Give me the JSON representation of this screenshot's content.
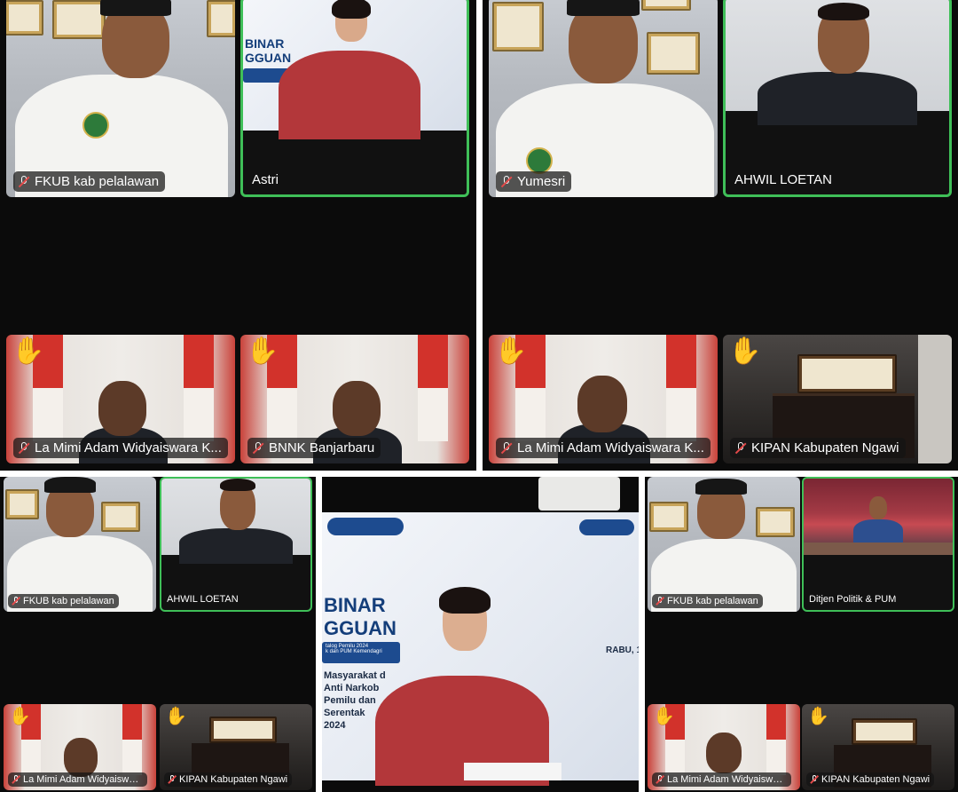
{
  "panels": [
    {
      "tiles": [
        {
          "name": "FKUB kab pelalawan",
          "muted": true
        },
        {
          "name": "Astri",
          "muted": false
        },
        {
          "name": "La Mimi Adam Widyaiswara K...",
          "muted": true,
          "hand_raised": true
        },
        {
          "name": "BNNK Banjarbaru",
          "muted": true,
          "hand_raised": true
        }
      ]
    },
    {
      "tiles": [
        {
          "name": "Yumesri",
          "muted": true
        },
        {
          "name": "AHWIL LOETAN",
          "muted": false
        },
        {
          "name": "La Mimi Adam Widyaiswara K...",
          "muted": true,
          "hand_raised": true
        },
        {
          "name": "KIPAN Kabupaten Ngawi",
          "muted": true,
          "hand_raised": true
        }
      ]
    },
    {
      "tiles": [
        {
          "name": "FKUB kab pelalawan",
          "muted": true
        },
        {
          "name": "AHWIL LOETAN",
          "muted": false
        },
        {
          "name": "La Mimi Adam Widyaiswara K...",
          "muted": true,
          "hand_raised": true
        },
        {
          "name": "KIPAN Kabupaten Ngawi",
          "muted": true,
          "hand_raised": true
        }
      ]
    },
    {
      "slide": {
        "title_line1": "BINAR",
        "title_line2": "GGUAN",
        "subtitle": "talog Pemilu 2024",
        "subtitle2": "k dan PUM Kemendagri",
        "lines": [
          "Masyarakat d",
          "Anti Narkob",
          "Pemilu dan",
          "Serentak",
          "2024"
        ],
        "day": "RABU, 1"
      }
    },
    {
      "tiles": [
        {
          "name": "FKUB kab pelalawan",
          "muted": true
        },
        {
          "name": "Ditjen Politik & PUM",
          "muted": false
        },
        {
          "name": "La Mimi Adam Widyaiswara K...",
          "muted": true,
          "hand_raised": true
        },
        {
          "name": "KIPAN Kabupaten Ngawi",
          "muted": true,
          "hand_raised": true
        }
      ]
    }
  ],
  "icons": {
    "muted": "mic-muted-icon",
    "hand": "raised-hand-icon"
  },
  "colors": {
    "active_speaker_border": "#3fbf58",
    "background": "#0b0b0b"
  }
}
